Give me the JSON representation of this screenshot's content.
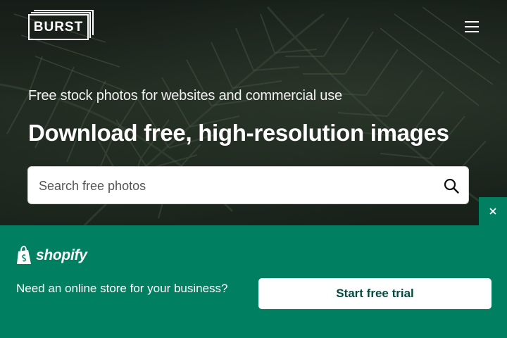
{
  "header": {
    "logo_text": "BURST"
  },
  "hero": {
    "tagline": "Free stock photos for websites and commercial use",
    "headline": "Download free, high-resolution images",
    "search": {
      "placeholder": "Search free photos"
    }
  },
  "banner": {
    "brand": "shopify",
    "message": "Need an online store for your business?",
    "cta_label": "Start free trial",
    "colors": {
      "background": "#008060",
      "button_text": "#004c3f"
    }
  },
  "icons": {
    "menu": "hamburger-menu-icon",
    "search": "search-icon",
    "close": "close-icon",
    "shopify_bag": "shopping-bag-icon"
  }
}
